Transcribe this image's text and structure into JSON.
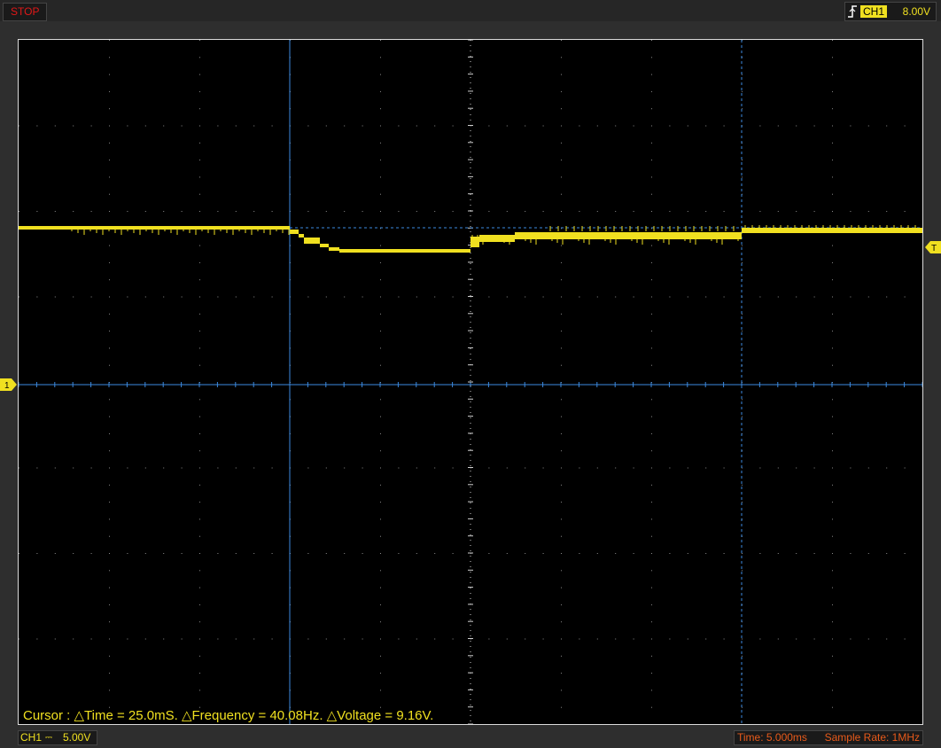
{
  "toolbar": {
    "run_state": "STOP",
    "trigger_channel": "CH1",
    "trigger_level": "8.00V"
  },
  "markers": {
    "channel_marker": "1",
    "trigger_marker": "T"
  },
  "cursor": {
    "readout": "Cursor : △Time = 25.0mS. △Frequency = 40.08Hz. △Voltage = 9.16V."
  },
  "channel": {
    "name": "CH1",
    "coupling_icon": "dc-coupling-icon",
    "volts_per_div": "5.00V"
  },
  "timebase": {
    "time_div": "Time: 5.000ms",
    "sample_rate": "Sample Rate: 1MHz"
  },
  "colors": {
    "trace": "#f0e020",
    "cursor": "#3c8ae0",
    "stop": "#e01818",
    "info": "#e85a1a"
  }
}
